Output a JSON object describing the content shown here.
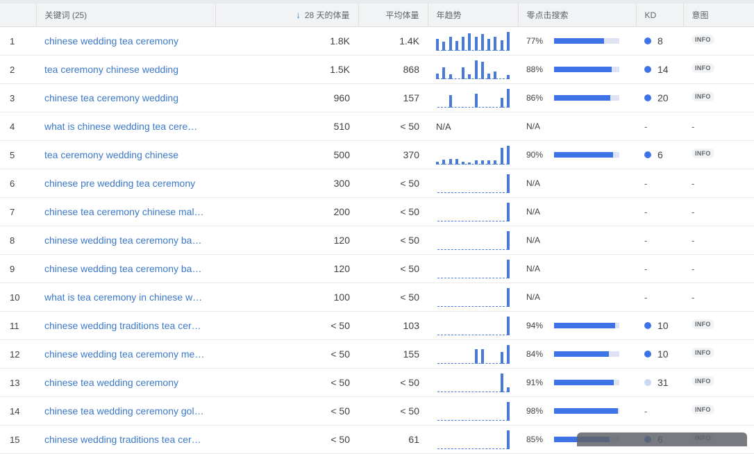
{
  "header": {
    "keyword_label": "关键词 (25)",
    "volume_label": "28 天的体量",
    "avg_label": "平均体量",
    "trend_label": "年趋势",
    "zero_click_label": "零点击搜索",
    "kd_label": "KD",
    "intent_label": "意图"
  },
  "sort_icon": "arrow-down-icon",
  "colors": {
    "link": "#3b78c7",
    "bar": "#3d73e6",
    "trend": "#4a7ad8",
    "track": "#dde3f3"
  },
  "rows": [
    {
      "idx": "1",
      "keyword": "chinese wedding tea ceremony",
      "volume": "1.8K",
      "avg": "1.4K",
      "trend": [
        0.6,
        0.45,
        0.7,
        0.5,
        0.7,
        0.9,
        0.7,
        0.85,
        0.6,
        0.7,
        0.55,
        0.95
      ],
      "zc_pct": "77%",
      "zc": 0.77,
      "kd": "8",
      "kd_light": false,
      "intent": "INFO"
    },
    {
      "idx": "2",
      "keyword": "tea ceremony chinese wedding",
      "volume": "1.5K",
      "avg": "868",
      "trend": [
        0.3,
        0.6,
        0.25,
        0,
        0.6,
        0.25,
        0.95,
        0.9,
        0.3,
        0.4,
        0,
        0.2
      ],
      "zc_pct": "88%",
      "zc": 0.88,
      "kd": "14",
      "kd_light": false,
      "intent": "INFO"
    },
    {
      "idx": "3",
      "keyword": "chinese tea ceremony wedding",
      "volume": "960",
      "avg": "157",
      "trend": [
        0,
        0,
        0.65,
        0,
        0,
        0,
        0.7,
        0,
        0,
        0,
        0.5,
        0.95
      ],
      "zc_pct": "86%",
      "zc": 0.86,
      "kd": "20",
      "kd_light": false,
      "intent": "INFO"
    },
    {
      "idx": "4",
      "keyword": "what is chinese wedding tea cere…",
      "volume": "510",
      "avg": "< 50",
      "trend": null,
      "zc_pct": "N/A",
      "zc": null,
      "kd": "-",
      "kd_light": false,
      "intent": "-"
    },
    {
      "idx": "5",
      "keyword": "tea ceremony wedding chinese",
      "volume": "500",
      "avg": "370",
      "trend": [
        0.15,
        0.25,
        0.3,
        0.3,
        0.15,
        0.1,
        0.2,
        0.2,
        0.2,
        0.2,
        0.85,
        0.95
      ],
      "zc_pct": "90%",
      "zc": 0.9,
      "kd": "6",
      "kd_light": false,
      "intent": "INFO"
    },
    {
      "idx": "6",
      "keyword": "chinese pre wedding tea ceremony",
      "volume": "300",
      "avg": "< 50",
      "trend": [
        0,
        0,
        0,
        0,
        0,
        0,
        0,
        0,
        0,
        0,
        0,
        0.95
      ],
      "zc_pct": "N/A",
      "zc": null,
      "kd": "-",
      "kd_light": false,
      "intent": "-"
    },
    {
      "idx": "7",
      "keyword": "chinese tea ceremony chinese mal…",
      "volume": "200",
      "avg": "< 50",
      "trend": [
        0,
        0,
        0,
        0,
        0,
        0,
        0,
        0,
        0,
        0,
        0,
        0.95
      ],
      "zc_pct": "N/A",
      "zc": null,
      "kd": "-",
      "kd_light": false,
      "intent": "-"
    },
    {
      "idx": "8",
      "keyword": "chinese wedding tea ceremony ba…",
      "volume": "120",
      "avg": "< 50",
      "trend": [
        0,
        0,
        0,
        0,
        0,
        0,
        0,
        0,
        0,
        0,
        0,
        0.95
      ],
      "zc_pct": "N/A",
      "zc": null,
      "kd": "-",
      "kd_light": false,
      "intent": "-"
    },
    {
      "idx": "9",
      "keyword": "chinese wedding tea ceremony ba…",
      "volume": "120",
      "avg": "< 50",
      "trend": [
        0,
        0,
        0,
        0,
        0,
        0,
        0,
        0,
        0,
        0,
        0,
        0.95
      ],
      "zc_pct": "N/A",
      "zc": null,
      "kd": "-",
      "kd_light": false,
      "intent": "-"
    },
    {
      "idx": "10",
      "keyword": "what is tea ceremony in chinese w…",
      "volume": "100",
      "avg": "< 50",
      "trend": [
        0,
        0,
        0,
        0,
        0,
        0,
        0,
        0,
        0,
        0,
        0,
        0.95
      ],
      "zc_pct": "N/A",
      "zc": null,
      "kd": "-",
      "kd_light": false,
      "intent": "-"
    },
    {
      "idx": "11",
      "keyword": "chinese wedding traditions tea cer…",
      "volume": "< 50",
      "avg": "103",
      "trend": [
        0,
        0,
        0,
        0,
        0,
        0,
        0,
        0,
        0,
        0,
        0,
        0.95
      ],
      "zc_pct": "94%",
      "zc": 0.94,
      "kd": "10",
      "kd_light": false,
      "intent": "INFO"
    },
    {
      "idx": "12",
      "keyword": "chinese wedding tea ceremony me…",
      "volume": "< 50",
      "avg": "155",
      "trend": [
        0,
        0,
        0,
        0,
        0,
        0,
        0.75,
        0.75,
        0,
        0,
        0.6,
        0.95
      ],
      "zc_pct": "84%",
      "zc": 0.84,
      "kd": "10",
      "kd_light": false,
      "intent": "INFO"
    },
    {
      "idx": "13",
      "keyword": "chinese tea wedding ceremony",
      "volume": "< 50",
      "avg": "< 50",
      "trend": [
        0,
        0,
        0,
        0,
        0,
        0,
        0,
        0,
        0,
        0,
        0.95,
        0.25
      ],
      "zc_pct": "91%",
      "zc": 0.91,
      "kd": "31",
      "kd_light": true,
      "intent": "INFO"
    },
    {
      "idx": "14",
      "keyword": "chinese tea wedding ceremony gol…",
      "volume": "< 50",
      "avg": "< 50",
      "trend": [
        0,
        0,
        0,
        0,
        0,
        0,
        0,
        0,
        0,
        0,
        0,
        0.95
      ],
      "zc_pct": "98%",
      "zc": 0.98,
      "kd": "-",
      "kd_light": false,
      "intent": "INFO"
    },
    {
      "idx": "15",
      "keyword": "chinese wedding traditions tea cer…",
      "volume": "< 50",
      "avg": "61",
      "trend": [
        0,
        0,
        0,
        0,
        0,
        0,
        0,
        0,
        0,
        0,
        0,
        0.95
      ],
      "zc_pct": "85%",
      "zc": 0.85,
      "kd": "6",
      "kd_light": false,
      "intent": "INFO"
    }
  ]
}
